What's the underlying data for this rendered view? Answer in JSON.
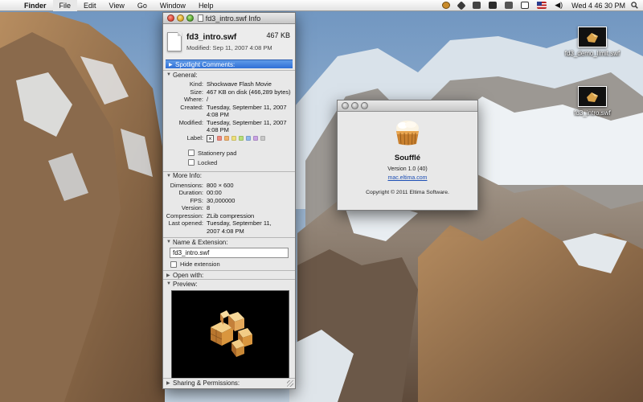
{
  "menubar": {
    "apple_glyph": "",
    "app_name": "Finder",
    "items": [
      "File",
      "Edit",
      "View",
      "Go",
      "Window",
      "Help"
    ],
    "status_icons": [
      "growl-icon",
      "dropbox-icon",
      "sync-icon",
      "evernote-icon",
      "network-icon",
      "display-icon",
      "us-flag-icon",
      "volume-icon"
    ],
    "clock": "Wed 4 46 30 PM"
  },
  "desktop_icons": [
    {
      "label": "fd3_demo_limit.swf"
    },
    {
      "label": "fd3_intro.swf"
    }
  ],
  "info_window": {
    "title": "fd3_intro.swf Info",
    "file_name": "fd3_intro.swf",
    "file_size": "467 KB",
    "modified_line": "Modified: Sep 11, 2007 4:08 PM",
    "spotlight_label": "Spotlight Comments:",
    "general": {
      "heading": "General:",
      "rows": [
        {
          "k": "Kind:",
          "v": "Shockwave Flash Movie"
        },
        {
          "k": "Size:",
          "v": "467 KB on disk (466,289 bytes)"
        },
        {
          "k": "Where:",
          "v": "/"
        },
        {
          "k": "Created:",
          "v": "Tuesday, September 11, 2007"
        },
        {
          "k": "",
          "v": "4:08 PM"
        },
        {
          "k": "Modified:",
          "v": "Tuesday, September 11, 2007"
        },
        {
          "k": "",
          "v": "4:08 PM"
        }
      ],
      "label_key": "Label:",
      "label_colors": [
        "#f08a7e",
        "#f2b36b",
        "#eee07a",
        "#b6e07a",
        "#8fb8ef",
        "#c9a3e4",
        "#c8c8c8"
      ],
      "stationery": "Stationery pad",
      "locked": "Locked"
    },
    "more_info": {
      "heading": "More Info:",
      "rows": [
        {
          "k": "Dimensions:",
          "v": "800 × 600"
        },
        {
          "k": "Duration:",
          "v": "00:00"
        },
        {
          "k": "FPS:",
          "v": "30,000000"
        },
        {
          "k": "Version:",
          "v": "8"
        },
        {
          "k": "Compression:",
          "v": "ZLib compression"
        },
        {
          "k": "Last opened:",
          "v": "Tuesday, September 11,"
        },
        {
          "k": "",
          "v": "2007 4:08 PM"
        }
      ]
    },
    "name_ext": {
      "heading": "Name & Extension:",
      "value": "fd3_intro.swf",
      "hide_extension": "Hide extension"
    },
    "open_with": "Open with:",
    "preview": "Preview:",
    "sharing": "Sharing & Permissions:"
  },
  "about_window": {
    "app_name": "Soufflé",
    "version": "Version 1.0 (40)",
    "link": "mac.eltima.com",
    "copyright": "Copyright © 2011 Eltima Software."
  },
  "colors": {
    "selection_blue": "#2f6fd6",
    "link_blue": "#1d4fb5"
  }
}
